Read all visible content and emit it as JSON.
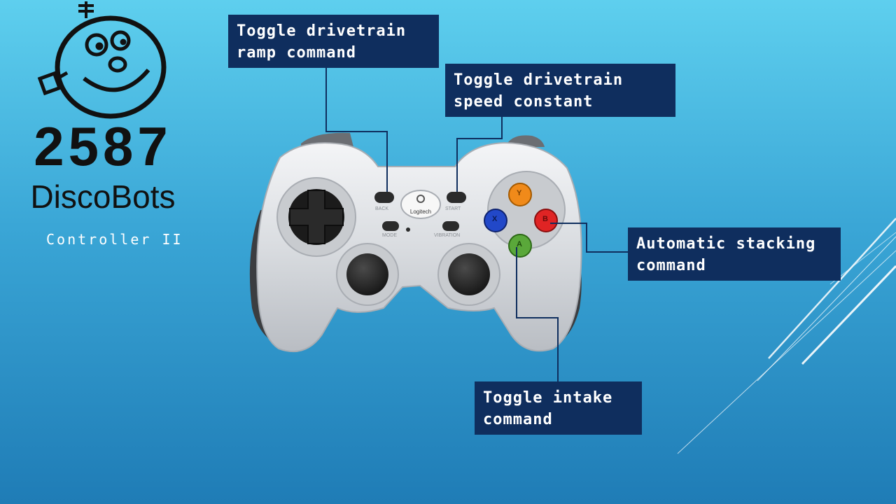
{
  "logo": {
    "number": "2587",
    "name": "DiscoBots"
  },
  "subtitle": "Controller II",
  "controller": {
    "brand": "Logitech",
    "button_labels": {
      "back": "BACK",
      "start": "START",
      "mode": "MODE",
      "vibration": "VIBRATION",
      "x": "X",
      "y": "Y",
      "b": "B",
      "a": "A"
    }
  },
  "callouts": {
    "ramp": {
      "line1": "Toggle drivetrain",
      "line2": "ramp command"
    },
    "speed": {
      "line1": "Toggle drivetrain",
      "line2": "speed constant"
    },
    "stacking": {
      "line1": "Automatic stacking",
      "line2": "command"
    },
    "intake": {
      "line1": "Toggle intake",
      "line2": "command"
    }
  },
  "colors": {
    "callout_bg": "#0f2e5e",
    "button_y": "#f08a1a",
    "button_b": "#e02424",
    "button_x": "#2248c8",
    "button_a": "#5aa83a"
  }
}
